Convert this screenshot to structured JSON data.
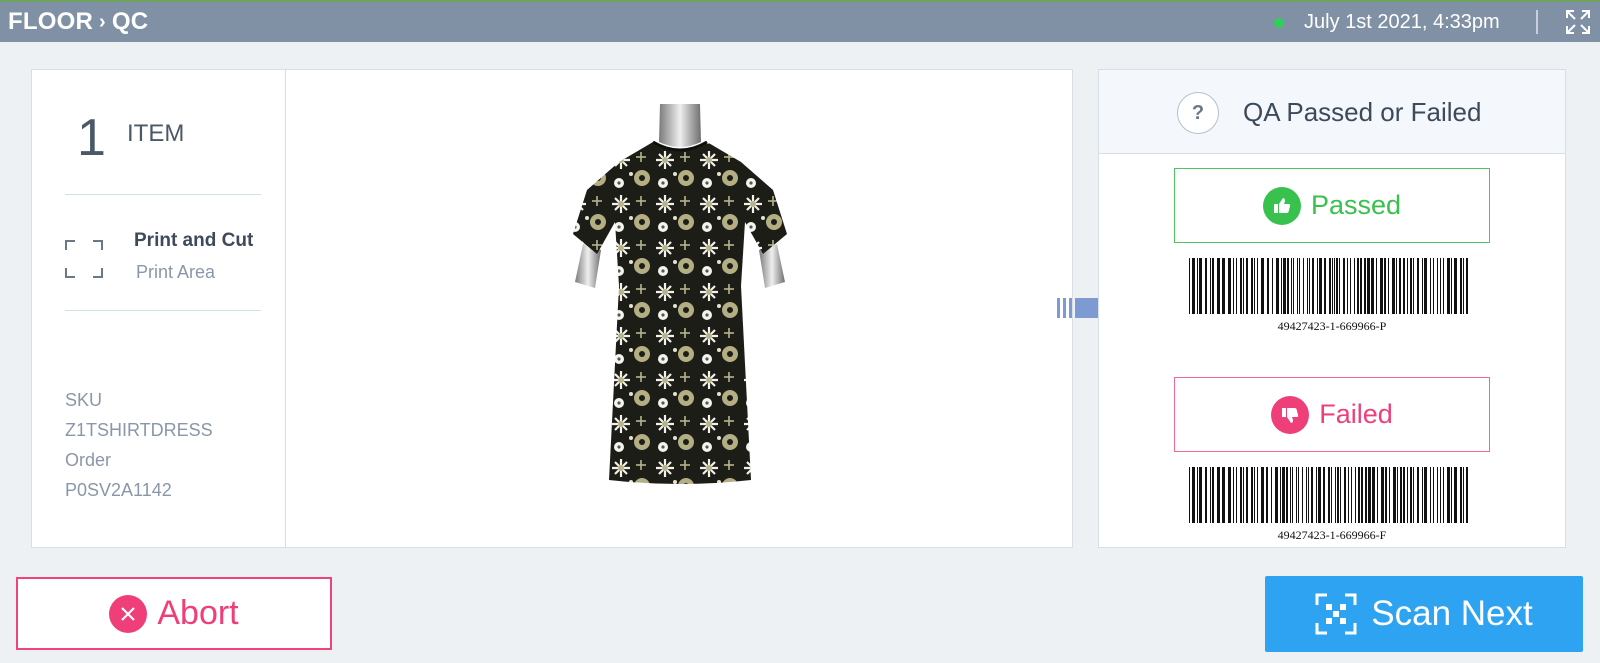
{
  "header": {
    "breadcrumb": [
      "FLOOR",
      "QC"
    ],
    "breadcrumb_separator": "›",
    "status_color": "#2ed158",
    "datetime": "July 1st 2021, 4:33pm",
    "expand_icon": "fullscreen-expand-icon"
  },
  "item": {
    "count": "1",
    "count_label": "ITEM",
    "process_title": "Print and Cut",
    "process_subtitle": "Print Area",
    "sku_label": "SKU",
    "sku_value": "Z1TSHIRTDRESS",
    "order_label": "Order",
    "order_value": "P0SV2A1142"
  },
  "qa": {
    "title": "QA Passed or Failed",
    "help_icon": "?",
    "passed_label": "Passed",
    "passed_barcode": "49427423-1-669966-P",
    "failed_label": "Failed",
    "failed_barcode": "49427423-1-669966-F",
    "colors": {
      "pass": "#39c14d",
      "fail": "#ef3f78"
    }
  },
  "actions": {
    "abort_label": "Abort",
    "scan_next_label": "Scan Next",
    "scan_color": "#2ea3f2"
  }
}
